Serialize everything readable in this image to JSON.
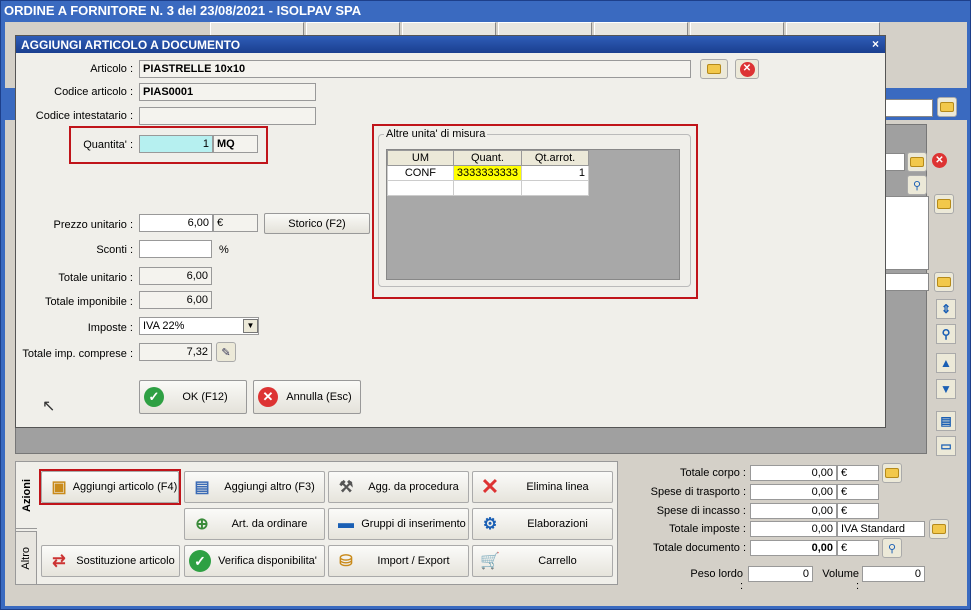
{
  "window": {
    "title": "ORDINE A FORNITORE N. 3 del 23/08/2021 - ISOLPAV SPA"
  },
  "dialog": {
    "title": "AGGIUNGI ARTICOLO A DOCUMENTO",
    "close_label": "×",
    "articolo_label": "Articolo :",
    "articolo_value": "PIASTRELLE 10x10",
    "codice_label": "Codice articolo :",
    "codice_value": "PIAS0001",
    "codice_int_label": "Codice intestatario :",
    "codice_int_value": "",
    "quantita_label": "Quantita' :",
    "quantita_value": "1",
    "um_value": "MQ",
    "prezzo_label": "Prezzo unitario :",
    "prezzo_value": "6,00",
    "prezzo_currency": "€",
    "storico_label": "Storico (F2)",
    "sconti_label": "Sconti :",
    "sconti_value": "",
    "sconti_unit": "%",
    "tot_unitario_label": "Totale unitario :",
    "tot_unitario_value": "6,00",
    "tot_imponibile_label": "Totale imponibile :",
    "tot_imponibile_value": "6,00",
    "imposte_label": "Imposte :",
    "imposte_value": "IVA 22%",
    "tot_imp_label": "Totale imp. comprese :",
    "tot_imp_value": "7,32",
    "ok_label": "OK (F12)",
    "annulla_label": "Annulla (Esc)",
    "altre_um": {
      "group_label": "Altre unita' di misura",
      "columns": [
        "UM",
        "Quant.",
        "Qt.arrot."
      ],
      "rows": [
        {
          "um": "CONF",
          "quant": "3333333333",
          "arrot": "1"
        }
      ]
    }
  },
  "tabs": {
    "azioni": "Azioni",
    "altro": "Altro"
  },
  "actions": {
    "aggiungi_articolo": "Aggiungi articolo (F4)",
    "aggiungi_altro": "Aggiungi altro (F3)",
    "agg_procedura": "Agg. da procedura",
    "elimina_linea": "Elimina linea",
    "art_ordinare": "Art. da ordinare",
    "gruppi_inserimento": "Gruppi di inserimento",
    "elaborazioni": "Elaborazioni",
    "sostituzione_articolo": "Sostituzione articolo",
    "verifica_disponibilita": "Verifica disponibilita'",
    "import_export": "Import / Export",
    "carrello": "Carrello"
  },
  "totals": {
    "totale_corpo_label": "Totale corpo :",
    "totale_corpo_value": "0,00",
    "spese_trasporto_label": "Spese di trasporto :",
    "spese_trasporto_value": "0,00",
    "spese_incasso_label": "Spese di incasso :",
    "spese_incasso_value": "0,00",
    "totale_imposte_label": "Totale imposte :",
    "totale_imposte_value": "0,00",
    "totale_imposte_desc": "IVA Standard",
    "totale_documento_label": "Totale documento :",
    "totale_documento_value": "0,00",
    "currency": "€",
    "peso_lordo_label": "Peso lordo :",
    "peso_lordo_value": "0",
    "volume_label": "Volume :",
    "volume_value": "0"
  },
  "colors": {
    "titlebar": "#3a6ac0",
    "highlight_red": "#c0141a",
    "quantita_bg": "#b6f0f0",
    "grid_cell_yellow": "#ffff00"
  }
}
